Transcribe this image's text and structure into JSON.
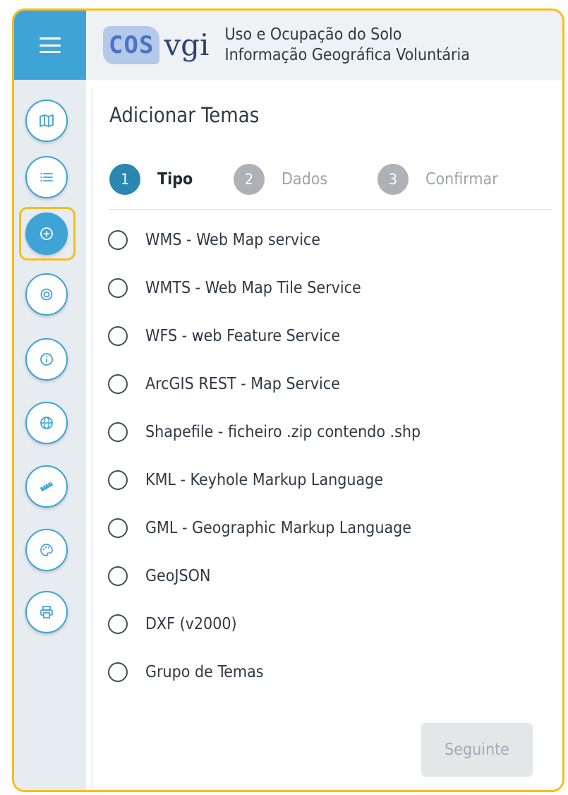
{
  "header": {
    "logo_cos": "COS",
    "logo_vgi": "vgi",
    "title_line1": "Uso e Ocupação do Solo",
    "title_line2": "Informação Geográfica Voluntária"
  },
  "sidebar": {
    "items": [
      {
        "icon": "map-icon",
        "active": false
      },
      {
        "icon": "list-icon",
        "active": false
      },
      {
        "icon": "add-circle-icon",
        "active": true
      },
      {
        "icon": "target-icon",
        "active": false
      },
      {
        "icon": "info-icon",
        "active": false
      },
      {
        "icon": "globe-icon",
        "active": false
      },
      {
        "icon": "ruler-icon",
        "active": false
      },
      {
        "icon": "palette-icon",
        "active": false
      },
      {
        "icon": "printer-icon",
        "active": false
      }
    ]
  },
  "panel": {
    "title": "Adicionar Temas",
    "steps": [
      {
        "number": "1",
        "label": "Tipo",
        "active": true
      },
      {
        "number": "2",
        "label": "Dados",
        "active": false
      },
      {
        "number": "3",
        "label": "Confirmar",
        "active": false
      }
    ],
    "options": [
      "WMS - Web Map service",
      "WMTS - Web Map Tile Service",
      "WFS - web Feature Service",
      "ArcGIS REST - Map Service",
      "Shapefile - ficheiro .zip contendo .shp",
      "KML - Keyhole Markup Language",
      "GML - Geographic Markup Language",
      "GeoJSON",
      "DXF (v2000)",
      "Grupo de Temas"
    ],
    "next_label": "Seguinte"
  },
  "colors": {
    "accent": "#3ea4d6",
    "step_active": "#2c86b2",
    "highlight": "#f7bd1a"
  }
}
